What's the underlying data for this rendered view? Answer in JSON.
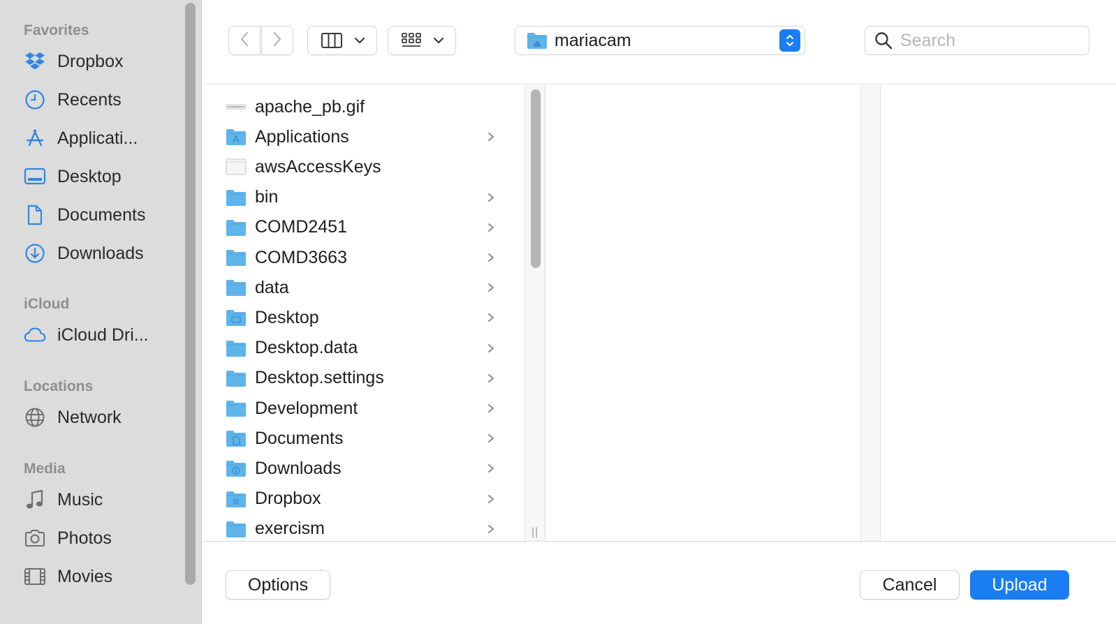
{
  "sidebar": {
    "sections": [
      {
        "title": "Favorites",
        "items": [
          {
            "label": "Dropbox",
            "icon": "dropbox-icon"
          },
          {
            "label": "Recents",
            "icon": "clock-icon"
          },
          {
            "label": "Applicati...",
            "icon": "applications-icon"
          },
          {
            "label": "Desktop",
            "icon": "desktop-icon"
          },
          {
            "label": "Documents",
            "icon": "document-icon"
          },
          {
            "label": "Downloads",
            "icon": "download-icon"
          }
        ]
      },
      {
        "title": "iCloud",
        "items": [
          {
            "label": "iCloud Dri...",
            "icon": "cloud-icon"
          }
        ]
      },
      {
        "title": "Locations",
        "items": [
          {
            "label": "Network",
            "icon": "globe-icon"
          }
        ]
      },
      {
        "title": "Media",
        "items": [
          {
            "label": "Music",
            "icon": "music-note-icon"
          },
          {
            "label": "Photos",
            "icon": "camera-icon"
          },
          {
            "label": "Movies",
            "icon": "film-icon"
          }
        ]
      }
    ]
  },
  "toolbar": {
    "path": "mariacam",
    "search_placeholder": "Search"
  },
  "files": [
    {
      "name": "apache_pb.gif",
      "kind": "image",
      "has_children": false
    },
    {
      "name": "Applications",
      "kind": "folder-apps",
      "has_children": true
    },
    {
      "name": "awsAccessKeys",
      "kind": "file",
      "has_children": false
    },
    {
      "name": "bin",
      "kind": "folder",
      "has_children": true
    },
    {
      "name": "COMD2451",
      "kind": "folder",
      "has_children": true
    },
    {
      "name": "COMD3663",
      "kind": "folder",
      "has_children": true
    },
    {
      "name": "data",
      "kind": "folder",
      "has_children": true
    },
    {
      "name": "Desktop",
      "kind": "folder-desktop",
      "has_children": true
    },
    {
      "name": "Desktop.data",
      "kind": "folder",
      "has_children": true
    },
    {
      "name": "Desktop.settings",
      "kind": "folder",
      "has_children": true
    },
    {
      "name": "Development",
      "kind": "folder",
      "has_children": true
    },
    {
      "name": "Documents",
      "kind": "folder-documents",
      "has_children": true
    },
    {
      "name": "Downloads",
      "kind": "folder-downloads",
      "has_children": true
    },
    {
      "name": "Dropbox",
      "kind": "folder-dropbox",
      "has_children": true
    },
    {
      "name": "exercism",
      "kind": "folder",
      "has_children": true
    }
  ],
  "footer": {
    "options_label": "Options",
    "cancel_label": "Cancel",
    "upload_label": "Upload"
  },
  "colors": {
    "accent": "#1a7ef2",
    "sidebar_icon": "#2f86e5",
    "folder": "#5fb4ea"
  }
}
